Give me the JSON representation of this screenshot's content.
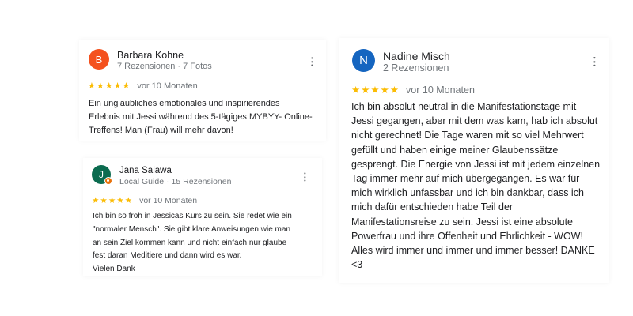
{
  "reviews": [
    {
      "avatar_letter": "B",
      "avatar_color": "#f4511e",
      "name": "Barbara Kohne",
      "meta": [
        "7 Rezensionen",
        "7 Fotos"
      ],
      "stars": "★★★★★",
      "rating": 5,
      "time": "vor 10 Monaten",
      "lines": [
        "Ein unglaubliches emotionales und inspirierendes",
        "Erlebnis mit Jessi während des 5-tägiges MYBYY- Online-",
        "Treffens! Man (Frau) will mehr davon!"
      ]
    },
    {
      "avatar_letter": "J",
      "avatar_color": "#0b6b4f",
      "name": "Jana Salawa",
      "meta": [
        "Local Guide",
        "15 Rezensionen"
      ],
      "stars": "★★★★★",
      "rating": 5,
      "time": "vor 10 Monaten",
      "lines": [
        "Ich bin so froh in Jessicas Kurs zu sein. Sie redet wie ein",
        "\"normaler Mensch\". Sie gibt klare Anweisungen wie man",
        "an sein Ziel kommen kann und nicht einfach nur glaube",
        "fest daran Meditiere und dann wird es war.",
        "Vielen Dank"
      ]
    },
    {
      "avatar_letter": "N",
      "avatar_color": "#1565c0",
      "name": "Nadine Misch",
      "meta": [
        "2 Rezensionen"
      ],
      "stars": "★★★★★",
      "rating": 5,
      "time": "vor 10 Monaten",
      "lines": [
        "Ich bin absolut neutral in die Manifestationstage mit",
        "Jessi gegangen, aber mit dem was kam, hab ich absolut",
        "nicht gerechnet! Die Tage waren mit so viel Mehrwert",
        "gefüllt und haben einige meiner Glaubenssätze",
        "gesprengt. Die Energie von Jessi ist mit jedem einzelnen",
        "Tag immer mehr auf mich übergegangen. Es war für",
        "mich wirklich unfassbar und ich bin dankbar, dass ich",
        "mich dafür entschieden habe Teil der",
        "Manifestationsreise zu sein. Jessi ist eine absolute",
        "Powerfrau und ihre Offenheit und Ehrlichkeit - WOW!",
        "Alles wird immer und immer und immer besser! DANKE",
        "<3"
      ]
    }
  ],
  "separator": "·",
  "icons": {
    "menu": "more-vert-icon",
    "star": "star-icon",
    "local_guide": "local-guide-badge-icon"
  },
  "colors": {
    "star": "#fbbc04",
    "meta_text": "#70757a",
    "body_text": "#202124"
  }
}
